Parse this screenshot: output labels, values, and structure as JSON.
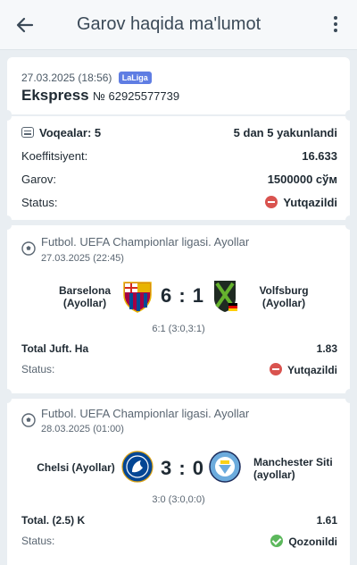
{
  "header": {
    "title": "Garov haqida ma'lumot"
  },
  "bet": {
    "datetime": "27.03.2025 (18:56)",
    "league_badge": "LaLiga",
    "type": "Ekspress",
    "number": "№ 62925577739"
  },
  "summary": {
    "events_label": "Voqealar: 5",
    "events_value": "5 dan 5 yakunlandi",
    "coef_label": "Koeffitsiyent:",
    "coef_value": "16.633",
    "stake_label": "Garov:",
    "stake_value": "1500000 сўм",
    "status_label": "Status:",
    "status_value": "Yutqazildi"
  },
  "events": [
    {
      "league": "Futbol. UEFA Championlar ligasi. Ayollar",
      "date": "27.03.2025 (22:45)",
      "home": [
        "Barselona",
        "(Ayollar)"
      ],
      "away": [
        "Volfsburg",
        "(Ayollar)"
      ],
      "score": "6 : 1",
      "detail": "6:1 (3:0,3:1)",
      "market": "Total Juft. Ha",
      "odds": "1.83",
      "status_label": "Status:",
      "status": "Yutqazildi"
    },
    {
      "league": "Futbol. UEFA Championlar ligasi. Ayollar",
      "date": "28.03.2025 (01:00)",
      "home": [
        "Chelsi (Ayollar)"
      ],
      "away": [
        "Manchester Siti",
        "(ayollar)"
      ],
      "score": "3 : 0",
      "detail": "3:0 (3:0,0:0)",
      "market": "Total. (2.5) K",
      "odds": "1.61",
      "status_label": "Status:",
      "status": "Qozonildi"
    }
  ],
  "colors": {
    "lose": "#c9302c",
    "win": "#34a853",
    "badge": "#5f7de3"
  },
  "icons": [
    "back-arrow-icon",
    "more-vertical-icon",
    "events-list-icon",
    "soccer-ball-icon",
    "status-lost-icon",
    "status-won-icon"
  ]
}
